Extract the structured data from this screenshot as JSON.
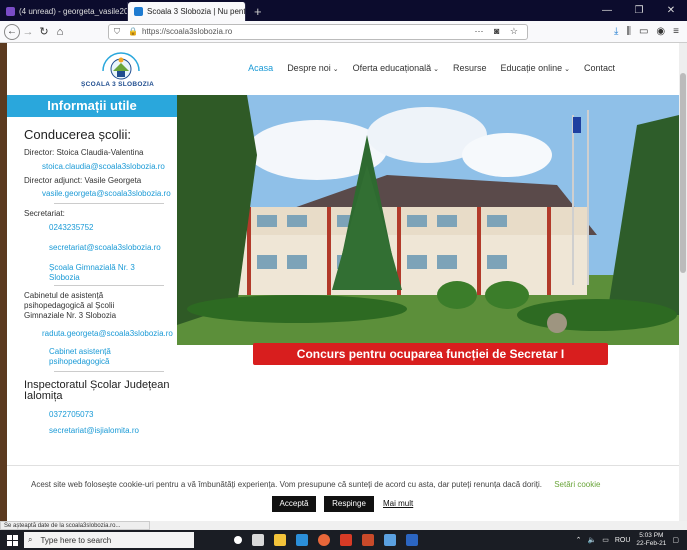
{
  "browser": {
    "tabs": [
      {
        "label": "(4 unread) - georgeta_vasile20..."
      },
      {
        "label": "Scoala 3 Slobozia | Nu pentru ș..."
      }
    ],
    "url": "https://scoala3slobozia.ro",
    "status": "Se așteaptă date de la scoala3slobozia.ro..."
  },
  "site": {
    "logo_text": "ȘCOALA 3 SLOBOZIA",
    "logo_arc": "ȘCOALA GIMNAZIALĂ NR. 3",
    "menu": [
      {
        "label": "Acasa"
      },
      {
        "label": "Despre noi"
      },
      {
        "label": "Oferta educațională"
      },
      {
        "label": "Resurse"
      },
      {
        "label": "Educație online"
      },
      {
        "label": "Contact"
      }
    ]
  },
  "sidebar": {
    "title": "Informații utile",
    "section1": "Conducerea școlii:",
    "director_label": "Director: Stoica Claudia-Valentina",
    "director_email": "stoica.claudia@scoala3slobozia.ro",
    "deputy_label": "Director adjunct: Vasile Georgeta",
    "deputy_email": "vasile.georgeta@scoala3slobozia.ro",
    "secretariat_label": "Secretariat:",
    "secretariat_phone": "0243235752",
    "secretariat_email": "secretariat@scoala3slobozia.ro",
    "school_link_1": "Școala Gimnazială Nr. 3",
    "school_link_2": "Slobozia",
    "cabinet_label_1": "Cabinetul de asistență",
    "cabinet_label_2": "psihopedagogică al Școlii",
    "cabinet_label_3": "Gimnaziale Nr. 3 Slobozia",
    "cabinet_email": "raduta.georgeta@scoala3slobozia.ro",
    "cabinet_link_1": "Cabinet asistență",
    "cabinet_link_2": "psihopedagogică",
    "isj_title_1": "Inspectoratul Școlar Județean",
    "isj_title_2": "Ialomița",
    "isj_phone": "0372705073",
    "isj_email": "secretariat@isjialomita.ro"
  },
  "banner": "Concurs pentru ocuparea funcției de Secretar I",
  "cookie": {
    "text": "Acest site web folosește cookie-uri pentru a vă îmbunătăți experiența. Vom presupune că sunteți de acord cu asta, dar puteți renunța dacă doriți.",
    "settings": "Setări cookie",
    "accept": "Acceptă",
    "reject": "Respinge",
    "more": "Mai mult"
  },
  "taskbar": {
    "search_placeholder": "Type here to search",
    "lang": "ROU",
    "time": "5:03 PM",
    "date": "22-Feb-21"
  }
}
